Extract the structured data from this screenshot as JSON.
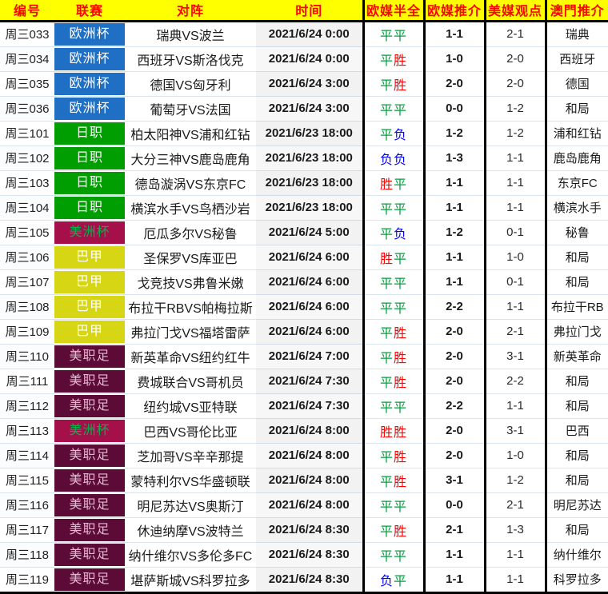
{
  "table": {
    "columns": [
      {
        "key": "id",
        "label": "编号"
      },
      {
        "key": "league",
        "label": "联赛"
      },
      {
        "key": "match",
        "label": "对阵"
      },
      {
        "key": "time",
        "label": "时间"
      },
      {
        "key": "eu_ht",
        "label": "欧媒半全"
      },
      {
        "key": "eu_tip",
        "label": "欧媒推介"
      },
      {
        "key": "us_view",
        "label": "美媒观点"
      },
      {
        "key": "mo_tip",
        "label": "澳門推介"
      }
    ],
    "colors": {
      "header_bg": "#ffff00",
      "header_fg": "#ff0000",
      "grid_rule": "#000000",
      "row_rule": "#d8e4ef",
      "time_bg": "#f2f2f2",
      "league_euro_cup_bg": "#1f6fc4",
      "league_euro_cup_fg": "#ffffff",
      "league_jleague_bg": "#009e00",
      "league_jleague_fg": "#ffffff",
      "league_copa_bg": "#a50f4a",
      "league_copa_fg": "#00b44b",
      "league_brasil_bg": "#d6d614",
      "league_brasil_fg": "#ffffff",
      "league_mls_bg": "#5c0a36",
      "league_mls_fg": "#e5b9d2",
      "token_win": "#ff0000",
      "token_draw": "#009e3c",
      "token_lose": "#0000ff"
    },
    "league_styles": {
      "欧洲杯": "lg-ec",
      "日职": "lg-jp",
      "美洲杯": "lg-ca",
      "巴甲": "lg-br",
      "美职足": "lg-ml"
    },
    "token_styles": {
      "胜": "ch-win",
      "平": "ch-draw",
      "负": "ch-lose"
    },
    "rows": [
      {
        "id": "周三033",
        "league": "欧洲杯",
        "match": "瑞典VS波兰",
        "time": "2021/6/24 0:00",
        "eu_ht": "平平",
        "eu_tip": "1-1",
        "us_view": "2-1",
        "mo_tip": "瑞典"
      },
      {
        "id": "周三034",
        "league": "欧洲杯",
        "match": "西班牙VS斯洛伐克",
        "time": "2021/6/24 0:00",
        "eu_ht": "平胜",
        "eu_tip": "1-0",
        "us_view": "2-0",
        "mo_tip": "西班牙"
      },
      {
        "id": "周三035",
        "league": "欧洲杯",
        "match": "德国VS匈牙利",
        "time": "2021/6/24 3:00",
        "eu_ht": "平胜",
        "eu_tip": "2-0",
        "us_view": "2-0",
        "mo_tip": "德国"
      },
      {
        "id": "周三036",
        "league": "欧洲杯",
        "match": "葡萄牙VS法国",
        "time": "2021/6/24 3:00",
        "eu_ht": "平平",
        "eu_tip": "0-0",
        "us_view": "1-2",
        "mo_tip": "和局"
      },
      {
        "id": "周三101",
        "league": "日职",
        "match": "柏太阳神VS浦和红钻",
        "time": "2021/6/23 18:00",
        "eu_ht": "平负",
        "eu_tip": "1-2",
        "us_view": "1-2",
        "mo_tip": "浦和红钻"
      },
      {
        "id": "周三102",
        "league": "日职",
        "match": "大分三神VS鹿岛鹿角",
        "time": "2021/6/23 18:00",
        "eu_ht": "负负",
        "eu_tip": "1-3",
        "us_view": "1-1",
        "mo_tip": "鹿岛鹿角"
      },
      {
        "id": "周三103",
        "league": "日职",
        "match": "德岛漩涡VS东京FC",
        "time": "2021/6/23 18:00",
        "eu_ht": "胜平",
        "eu_tip": "1-1",
        "us_view": "1-1",
        "mo_tip": "东京FC"
      },
      {
        "id": "周三104",
        "league": "日职",
        "match": "横滨水手VS鸟栖沙岩",
        "time": "2021/6/23 18:00",
        "eu_ht": "平平",
        "eu_tip": "1-1",
        "us_view": "1-1",
        "mo_tip": "横滨水手"
      },
      {
        "id": "周三105",
        "league": "美洲杯",
        "match": "厄瓜多尔VS秘鲁",
        "time": "2021/6/24 5:00",
        "eu_ht": "平负",
        "eu_tip": "1-2",
        "us_view": "0-1",
        "mo_tip": "秘鲁"
      },
      {
        "id": "周三106",
        "league": "巴甲",
        "match": "圣保罗VS库亚巴",
        "time": "2021/6/24 6:00",
        "eu_ht": "胜平",
        "eu_tip": "1-1",
        "us_view": "1-0",
        "mo_tip": "和局"
      },
      {
        "id": "周三107",
        "league": "巴甲",
        "match": "戈竞技VS弗鲁米嫩",
        "time": "2021/6/24 6:00",
        "eu_ht": "平平",
        "eu_tip": "1-1",
        "us_view": "0-1",
        "mo_tip": "和局"
      },
      {
        "id": "周三108",
        "league": "巴甲",
        "match": "布拉干RBVS帕梅拉斯",
        "time": "2021/6/24 6:00",
        "eu_ht": "平平",
        "eu_tip": "2-2",
        "us_view": "1-1",
        "mo_tip": "布拉干RB"
      },
      {
        "id": "周三109",
        "league": "巴甲",
        "match": "弗拉门戈VS福塔雷萨",
        "time": "2021/6/24 6:00",
        "eu_ht": "平胜",
        "eu_tip": "2-0",
        "us_view": "2-1",
        "mo_tip": "弗拉门戈"
      },
      {
        "id": "周三110",
        "league": "美职足",
        "match": "新英革命VS纽约红牛",
        "time": "2021/6/24 7:00",
        "eu_ht": "平胜",
        "eu_tip": "2-0",
        "us_view": "3-1",
        "mo_tip": "新英革命"
      },
      {
        "id": "周三111",
        "league": "美职足",
        "match": "费城联合VS哥机员",
        "time": "2021/6/24 7:30",
        "eu_ht": "平胜",
        "eu_tip": "2-0",
        "us_view": "2-2",
        "mo_tip": "和局"
      },
      {
        "id": "周三112",
        "league": "美职足",
        "match": "纽约城VS亚特联",
        "time": "2021/6/24 7:30",
        "eu_ht": "平平",
        "eu_tip": "2-2",
        "us_view": "1-1",
        "mo_tip": "和局"
      },
      {
        "id": "周三113",
        "league": "美洲杯",
        "match": "巴西VS哥伦比亚",
        "time": "2021/6/24 8:00",
        "eu_ht": "胜胜",
        "eu_tip": "2-0",
        "us_view": "3-1",
        "mo_tip": "巴西"
      },
      {
        "id": "周三114",
        "league": "美职足",
        "match": "芝加哥VS辛辛那提",
        "time": "2021/6/24 8:00",
        "eu_ht": "平胜",
        "eu_tip": "2-0",
        "us_view": "1-0",
        "mo_tip": "和局"
      },
      {
        "id": "周三115",
        "league": "美职足",
        "match": "蒙特利尔VS华盛顿联",
        "time": "2021/6/24 8:00",
        "eu_ht": "平胜",
        "eu_tip": "3-1",
        "us_view": "1-2",
        "mo_tip": "和局"
      },
      {
        "id": "周三116",
        "league": "美职足",
        "match": "明尼苏达VS奥斯汀",
        "time": "2021/6/24 8:00",
        "eu_ht": "平平",
        "eu_tip": "0-0",
        "us_view": "2-1",
        "mo_tip": "明尼苏达"
      },
      {
        "id": "周三117",
        "league": "美职足",
        "match": "休迪纳摩VS波特兰",
        "time": "2021/6/24 8:30",
        "eu_ht": "平胜",
        "eu_tip": "2-1",
        "us_view": "1-3",
        "mo_tip": "和局"
      },
      {
        "id": "周三118",
        "league": "美职足",
        "match": "纳什维尔VS多伦多FC",
        "time": "2021/6/24 8:30",
        "eu_ht": "平平",
        "eu_tip": "1-1",
        "us_view": "1-1",
        "mo_tip": "纳什维尔"
      },
      {
        "id": "周三119",
        "league": "美职足",
        "match": "堪萨斯城VS科罗拉多",
        "time": "2021/6/24 8:30",
        "eu_ht": "负平",
        "eu_tip": "1-1",
        "us_view": "1-1",
        "mo_tip": "科罗拉多"
      }
    ]
  }
}
